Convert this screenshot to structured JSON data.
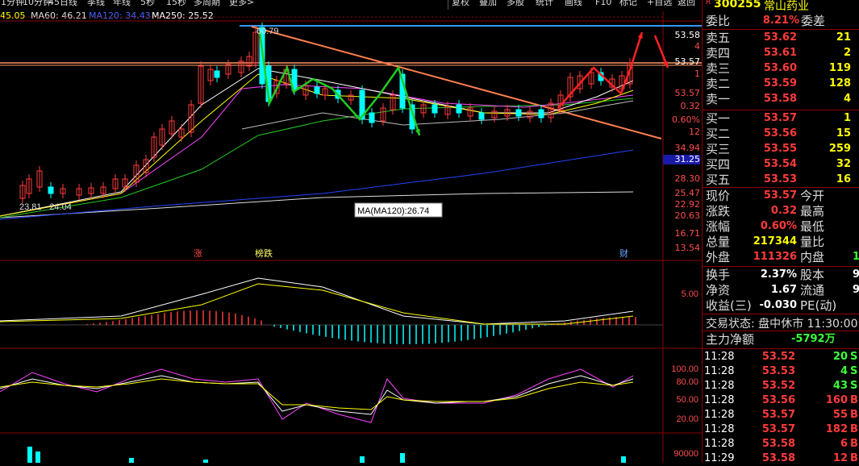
{
  "toolbar": {
    "items": [
      "1分钟",
      "10分钟",
      "45日线",
      "季线",
      "年线",
      "5秒",
      "15秒",
      "多周期",
      "更多>"
    ],
    "right_items": [
      "复权",
      "叠加",
      "多股",
      "统计",
      "画线",
      "F10",
      "标记",
      "+自选",
      "返回"
    ]
  },
  "ma_legend": {
    "ma_a": "45.05",
    "ma60": "MA60: 46.21",
    "ma120": "MA120: 34.43",
    "ma250": "MA250: 25.52"
  },
  "stock": {
    "code": "300255",
    "name": "常山药业",
    "badge": "R"
  },
  "order_book": {
    "weibi_label": "委比",
    "weibi_value": "8.21%",
    "weicha_label": "委差",
    "asks": [
      {
        "label": "卖五",
        "price": "53.62",
        "vol": "21"
      },
      {
        "label": "卖四",
        "price": "53.61",
        "vol": "2"
      },
      {
        "label": "卖三",
        "price": "53.60",
        "vol": "119"
      },
      {
        "label": "卖二",
        "price": "53.59",
        "vol": "128"
      },
      {
        "label": "卖一",
        "price": "53.58",
        "vol": "4"
      }
    ],
    "bids": [
      {
        "label": "买一",
        "price": "53.57",
        "vol": "1"
      },
      {
        "label": "买二",
        "price": "53.56",
        "vol": "15"
      },
      {
        "label": "买三",
        "price": "53.55",
        "vol": "259"
      },
      {
        "label": "买四",
        "price": "53.54",
        "vol": "32"
      },
      {
        "label": "买五",
        "price": "53.53",
        "vol": "16"
      }
    ]
  },
  "quote": [
    {
      "l": "现价",
      "v": "53.57",
      "r": "今开"
    },
    {
      "l": "涨跌",
      "v": "0.32",
      "r": "最高"
    },
    {
      "l": "涨幅",
      "v": "0.60%",
      "r": "最低"
    },
    {
      "l": "总量",
      "v": "217344",
      "r": "量比"
    },
    {
      "l": "外盘",
      "v": "111326",
      "r": "内盘",
      "rv": "1"
    }
  ],
  "stats": [
    {
      "l": "换手",
      "v": "2.37%",
      "r": "股本",
      "rv": "9"
    },
    {
      "l": "净资",
      "v": "1.67",
      "r": "流通",
      "rv": "9"
    },
    {
      "l": "收益(三)",
      "v": "-0.030",
      "r": "PE(动)",
      "rv": ""
    }
  ],
  "trade_status": "交易状态: 盘中休市 11:30:00",
  "main_flow": {
    "label": "主力净额",
    "value": "-5792万"
  },
  "ticks": [
    {
      "t": "11:28",
      "p": "53.52",
      "v": "20",
      "s": "S"
    },
    {
      "t": "11:28",
      "p": "53.53",
      "v": "4",
      "s": "S"
    },
    {
      "t": "11:28",
      "p": "53.52",
      "v": "43",
      "s": "S"
    },
    {
      "t": "11:28",
      "p": "53.56",
      "v": "160",
      "s": "B"
    },
    {
      "t": "11:28",
      "p": "53.57",
      "v": "55",
      "s": "B"
    },
    {
      "t": "11:28",
      "p": "53.57",
      "v": "182",
      "s": "B"
    },
    {
      "t": "11:28",
      "p": "53.58",
      "v": "6",
      "s": "B"
    },
    {
      "t": "11:29",
      "p": "53.58",
      "v": "12",
      "s": "B"
    }
  ],
  "price_axis": [
    "53.58",
    "4",
    "53.57",
    "1",
    "53.57",
    "0.32",
    "0.60%",
    "12",
    "34.94",
    "31.25",
    "28.30",
    "25.47",
    "22.92",
    "20.63",
    "16.71",
    "13.54"
  ],
  "chart_labels": {
    "high_mark": "60.79",
    "low_mark": "23.81 - 24.04",
    "ma_tooltip": "MA(MA120):26.74",
    "event_zhang": "涨",
    "event_bang": "榜跌",
    "event_cai": "财",
    "macd_tick": "5.00",
    "kdj_ticks": [
      "100.00",
      "80.00",
      "50.00",
      "20.00"
    ],
    "vol_tick": "90000"
  },
  "colors": {
    "up": "#ff3b3b",
    "down": "#00ffff",
    "ma_white": "#ffffff",
    "ma_yellow": "#ffff00",
    "ma_magenta": "#ff44ff",
    "ma_green": "#22cc22",
    "ma_blue": "#2244ff",
    "trend": "#ff7f50",
    "arrow_green": "#22cc22",
    "arrow_red": "#ff2222"
  }
}
